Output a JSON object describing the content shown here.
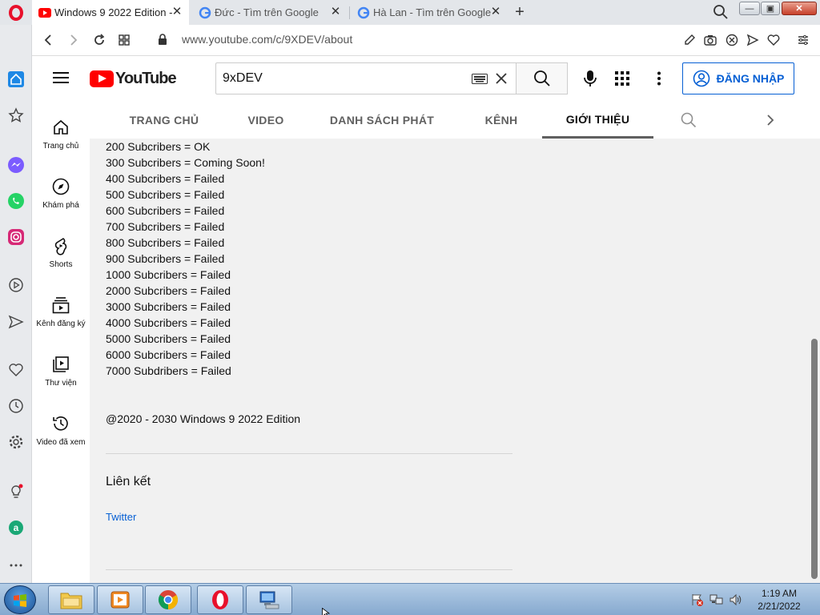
{
  "browser": {
    "tabs": [
      {
        "title": "Windows 9 2022 Edition - \\",
        "favicon": "youtube-icon",
        "active": true
      },
      {
        "title": "Đức - Tìm trên Google",
        "favicon": "google-icon",
        "active": false
      },
      {
        "title": "Hà Lan - Tìm trên Google",
        "favicon": "google-icon",
        "active": false
      }
    ],
    "url": "www.youtube.com/c/9XDEV/about"
  },
  "youtube": {
    "logo_text": "YouTube",
    "search_value": "9xDEV",
    "signin_label": "ĐĂNG NHẬP",
    "guide": [
      {
        "label": "Trang chủ",
        "icon": "home-icon"
      },
      {
        "label": "Khám phá",
        "icon": "compass-icon"
      },
      {
        "label": "Shorts",
        "icon": "shorts-icon"
      },
      {
        "label": "Kênh đăng ký",
        "icon": "subscriptions-icon"
      },
      {
        "label": "Thư viện",
        "icon": "library-icon"
      },
      {
        "label": "Video đã xem",
        "icon": "history-icon"
      }
    ],
    "channel_tabs": [
      "TRANG CHỦ",
      "VIDEO",
      "DANH SÁCH PHÁT",
      "KÊNH",
      "GIỚI THIỆU"
    ],
    "active_tab": "GIỚI THIỆU"
  },
  "about": {
    "description_lines": [
      "200 Subcribers = OK",
      "300 Subcribers = Coming Soon!",
      "400 Subcribers = Failed",
      "500 Subcribers = Failed",
      "600 Subcribers = Failed",
      "700 Subcribers = Failed",
      "800 Subcribers = Failed",
      "900 Subcribers = Failed",
      "1000 Subcribers = Failed",
      "2000 Subcribers = Failed",
      "3000 Subcribers = Failed",
      "4000 Subcribers = Failed",
      "5000 Subcribers = Failed",
      "6000 Subcribers = Failed",
      "7000 Subdribers = Failed"
    ],
    "copyright": "@2020 - 2030 Windows 9 2022 Edition",
    "links_title": "Liên kết",
    "links": [
      "Twitter"
    ]
  },
  "taskbar": {
    "time": "1:19 AM",
    "date": "2/21/2022"
  },
  "colors": {
    "youtube_red": "#ff0000",
    "link_blue": "#065fd4",
    "opera_red": "#e8102b"
  }
}
